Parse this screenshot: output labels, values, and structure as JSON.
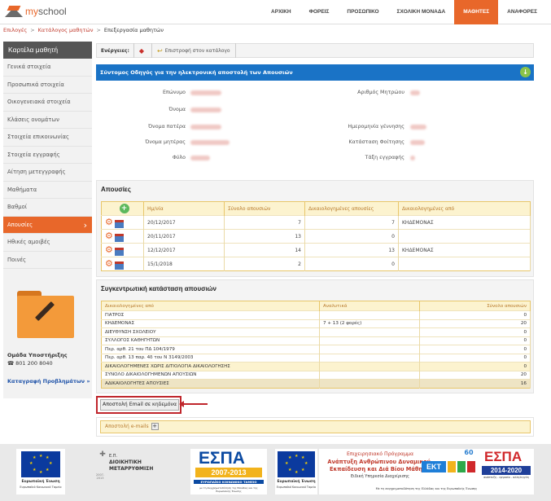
{
  "app": {
    "logo_my": "my",
    "logo_school": "school"
  },
  "nav": [
    "ΑΡΧΙΚΗ",
    "ΦΟΡΕΙΣ",
    "ΠΡΟΣΩΠΙΚΟ",
    "ΣΧΟΛΙΚΗ ΜΟΝΑΔΑ",
    "ΜΑΘΗΤΕΣ",
    "ΑΝΑΦΟΡΕΣ"
  ],
  "nav_active": "ΜΑΘΗΤΕΣ",
  "breadcrumb": {
    "b1": "Επιλογές",
    "b2": "Κατάλογος μαθητών",
    "b3": "Επεξεργασία μαθητών"
  },
  "sidebar": {
    "title": "Καρτέλα μαθητή",
    "items": [
      "Γενικά στοιχεία",
      "Προσωπικά στοιχεία",
      "Οικογενειακά στοιχεία",
      "Κλάσεις ονομάτων",
      "Στοιχεία επικοινωνίας",
      "Στοιχεία εγγραφής",
      "Αίτηση μετεγγραφής",
      "Μαθήματα",
      "Βαθμοί",
      "Απουσίες",
      "Ηθικές αμοιβές",
      "Ποινές"
    ],
    "active_index": 9,
    "support_title": "Ομάδα Υποστήριξης",
    "support_phone": "☎ 801 200 8040",
    "support_link": "Καταγραφή Προβλημάτων »"
  },
  "toolbar": {
    "label": "Ενέργειες:",
    "back": "Επιστροφή στον κατάλογο"
  },
  "guide_bar": "Σύντομος Οδηγός για την ηλεκτρονική αποστολή των Απουσιών",
  "info": {
    "left": [
      "Επώνυμο",
      "Όνομα",
      "Όνομα πατέρα",
      "Όνομα μητέρας",
      "Φύλο"
    ],
    "right": [
      "Αριθμός Μητρώου",
      "Ημερομηνία γέννησης",
      "Κατάσταση Φοίτησης",
      "Τάξη εγγραφής"
    ]
  },
  "absences": {
    "title": "Απουσίες",
    "headers": [
      "Ημ/νία",
      "Σύνολο απουσιών",
      "Δικαιολογημένες απουσίες",
      "Δικαιολογημένες από"
    ],
    "rows": [
      {
        "date": "20/12/2017",
        "total": "7",
        "justified": "7",
        "by": "ΚΗΔΕΜΟΝΑΣ"
      },
      {
        "date": "20/11/2017",
        "total": "13",
        "justified": "0",
        "by": ""
      },
      {
        "date": "12/12/2017",
        "total": "14",
        "justified": "13",
        "by": "ΚΗΔΕΜΟΝΑΣ"
      },
      {
        "date": "15/1/2018",
        "total": "2",
        "justified": "0",
        "by": ""
      }
    ]
  },
  "summary": {
    "title": "Συγκεντρωτική κατάσταση απουσιών",
    "headers": [
      "Δικαιολογημένες από",
      "Αναλυτικά",
      "Σύνολο απουσιών"
    ],
    "rows": [
      {
        "label": "ΓΙΑΤΡΟΣ",
        "detail": "",
        "value": "0"
      },
      {
        "label": "ΚΗΔΕΜΟΝΑΣ",
        "detail": "7 + 13 (2 φορές)",
        "value": "20"
      },
      {
        "label": "ΔΙΕΥΘΥΝΣΗ ΣΧΟΛΕΙΟΥ",
        "detail": "",
        "value": "0"
      },
      {
        "label": "ΣΥΛΛΟΓΟΣ ΚΑΘΗΓΗΤΩΝ",
        "detail": "",
        "value": "0"
      },
      {
        "label": "Περ. αρθ. 21 του ΠΔ 104/1979",
        "detail": "",
        "value": "0"
      },
      {
        "label": "Περ. αρθ. 13 παρ. 4δ του Ν 3149/2003",
        "detail": "",
        "value": "0"
      },
      {
        "label": "ΔΙΚΑΙΟΛΟΓΗΜΕΝΕΣ ΧΩΡΙΣ ΔΙΤΙΟΛΟΓΙΑ ΔΙΚΑΙΟΛΟΓΗΣΗΣ",
        "detail": "",
        "value": "0"
      },
      {
        "label": "ΣΥΝΟΛΟ ΔΙΚΑΙΟΛΟΓΗΜΕΝΩΝ ΑΠΟΥΣΙΩΝ",
        "detail": "",
        "value": "20"
      },
      {
        "label": "ΑΔΙΚΑΙΟΛΟΓΗΤΕΣ ΑΠΟΥΣΙΕΣ",
        "detail": "",
        "value": "16"
      }
    ]
  },
  "email_button": "Αποστολή Email σε κηδεμόνα",
  "email_section": "Αποστολή e-mails",
  "footer": {
    "eu1": "Ευρωπαϊκή Ένωση",
    "eu1_sub": "Ευρωπαϊκό Κοινωνικό Ταμείο",
    "ep": "Ε.Π.",
    "dm1": "ΔΙΟΙΚΗΤΙΚΗ",
    "dm2": "ΜΕΤΑΡΡΥΘΜΙΣΗ",
    "dm_years": "2007-2013",
    "espa1": "ΕΣΠΑ",
    "espa1_years": "2007-2013",
    "espa1_sub": "ΕΥΡΩΠΑΪΚΟ ΚΟΙΝΩΝΙΚΟ ΤΑΜΕΙΟ",
    "espa1_small": "με τη συγχρηματοδότηση της Ελλάδας και της Ευρωπαϊκής Ένωσης",
    "eu2": "Ευρωπαϊκή Ένωση",
    "eu2_sub": "Ευρωπαϊκό Κοινωνικό Ταμείο",
    "ep_line1": "Επιχειρησιακό Πρόγραμμα",
    "ep_line2": "Ανάπτυξη Ανθρώπινου Δυναμικού,",
    "ep_line3": "Εκπαίδευση και Διά Βίου Μάθηση",
    "ep_line4": "Ειδική Υπηρεσία Διαχείρισης",
    "ep_line5": "Με τη συγχρηματοδότηση της Ελλάδας και της Ευρωπαϊκής Ένωσης",
    "ekt": "ΕΚΤ",
    "sixty": "60",
    "espa2": "ΕΣΠΑ",
    "espa2_years": "2014-2020",
    "espa2_sub": "ανάπτυξη - εργασία - αλληλεγγύη"
  }
}
